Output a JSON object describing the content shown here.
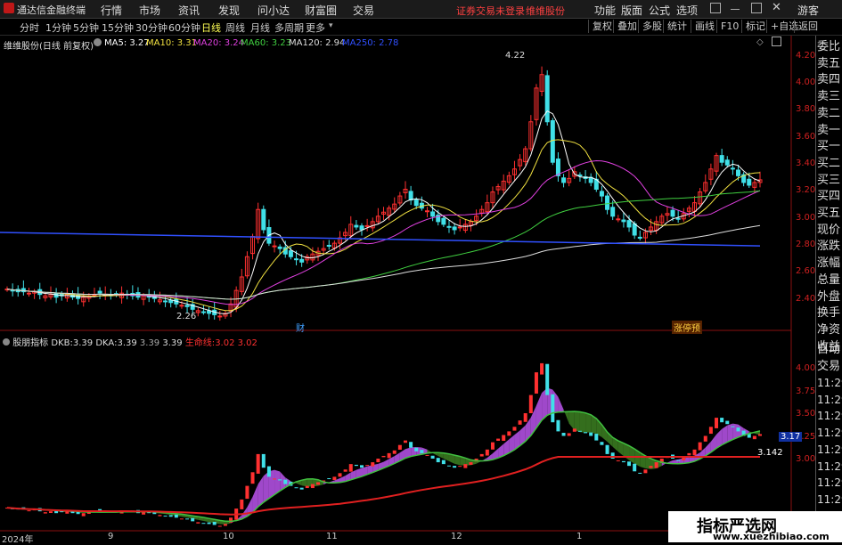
{
  "app": {
    "name": "通达信金融终端",
    "menu": [
      "行情",
      "市场",
      "资讯",
      "发现",
      "问小达",
      "财富圈",
      "交易"
    ],
    "notice": "证券交易未登录",
    "stock_tag": "维维股份",
    "right_menu": [
      "功能",
      "版面",
      "公式",
      "选项"
    ],
    "guest": "游客"
  },
  "period_tabs": [
    "分时",
    "1分钟",
    "5分钟",
    "15分钟",
    "30分钟",
    "60分钟",
    "日线",
    "周线",
    "月线",
    "多周期",
    "更多"
  ],
  "active_period": "日线",
  "toolbar": [
    "复权",
    "叠加",
    "多股",
    "统计",
    "画线",
    "F10",
    "标记",
    "+自选",
    "返回"
  ],
  "main_legend": {
    "title": "维维股份(日线 前复权)",
    "ma": [
      {
        "label": "MA5:",
        "value": "3.27",
        "color": "#ffffff"
      },
      {
        "label": "MA10:",
        "value": "3.31",
        "color": "#f0e040"
      },
      {
        "label": "MA20:",
        "value": "3.24",
        "color": "#e040e0"
      },
      {
        "label": "MA60:",
        "value": "3.23",
        "color": "#40d040"
      },
      {
        "label": "MA120:",
        "value": "2.94",
        "color": "#dddddd"
      },
      {
        "label": "MA250:",
        "value": "2.78",
        "color": "#3050ff"
      }
    ]
  },
  "main_axis": [
    "4.20",
    "4.00",
    "3.80",
    "3.60",
    "3.40",
    "3.20",
    "3.00",
    "2.80",
    "2.60",
    "2.40"
  ],
  "price_marks": {
    "high": "4.22",
    "low": "2.26"
  },
  "event_marks": {
    "cai": "财",
    "zhangting": "涨停预"
  },
  "indicator_legend": {
    "name": "股朋指标",
    "dkb_label": "DKB:",
    "dkb": "3.39",
    "dka_label": "DKA:",
    "dka": "3.39",
    "v3": "3.39",
    "v4": "3.39",
    "life_label": "生命线:",
    "life": "3.02",
    "life2": "3.02"
  },
  "ind_axis": [
    "4.00",
    "3.75",
    "3.50",
    "3.25",
    "3.00"
  ],
  "ind_current": "3.17",
  "ind_life_value": "3.142",
  "date_labels": [
    "2024年",
    "9",
    "10",
    "11",
    "12",
    "1"
  ],
  "side_quote": [
    "委比",
    "卖五",
    "卖四",
    "卖三",
    "卖二",
    "卖一",
    "买一",
    "买二",
    "买三",
    "买四",
    "买五",
    "现价",
    "涨跌",
    "涨幅",
    "总量",
    "外盘",
    "换手",
    "净资",
    "收益"
  ],
  "side_trade": [
    "自动",
    "交易"
  ],
  "side_times": [
    "11:29",
    "11:29",
    "11:29",
    "11:29",
    "11:29",
    "11:29",
    "11:29",
    "11:29",
    "11:29",
    "11:29"
  ],
  "watermark": {
    "title": "指标严选网",
    "url": "www.xuezhibiao.com"
  },
  "chart_data": {
    "type": "candlestick",
    "price_range": [
      2.26,
      4.22
    ],
    "closes": [
      2.46,
      2.45,
      2.44,
      2.44,
      2.43,
      2.44,
      2.42,
      2.41,
      2.42,
      2.4,
      2.41,
      2.42,
      2.4,
      2.39,
      2.4,
      2.41,
      2.42,
      2.43,
      2.42,
      2.41,
      2.42,
      2.43,
      2.42,
      2.41,
      2.4,
      2.41,
      2.4,
      2.39,
      2.38,
      2.37,
      2.36,
      2.35,
      2.34,
      2.33,
      2.31,
      2.3,
      2.29,
      2.28,
      2.27,
      2.26,
      2.28,
      2.35,
      2.45,
      2.55,
      2.7,
      2.85,
      3.05,
      2.9,
      2.8,
      2.78,
      2.76,
      2.72,
      2.7,
      2.68,
      2.66,
      2.7,
      2.72,
      2.74,
      2.76,
      2.78,
      2.8,
      2.84,
      2.88,
      2.94,
      2.92,
      2.9,
      2.93,
      2.96,
      3.0,
      3.03,
      3.06,
      3.09,
      3.15,
      3.2,
      3.12,
      3.08,
      3.06,
      3.04,
      3.0,
      2.96,
      2.94,
      2.92,
      2.9,
      2.92,
      2.94,
      2.96,
      3.0,
      3.05,
      3.1,
      3.18,
      3.22,
      3.26,
      3.3,
      3.35,
      3.42,
      3.5,
      3.7,
      3.95,
      4.05,
      3.7,
      3.4,
      3.3,
      3.25,
      3.28,
      3.33,
      3.3,
      3.28,
      3.25,
      3.2,
      3.15,
      3.05,
      3.0,
      2.98,
      2.96,
      2.92,
      2.86,
      2.84,
      2.88,
      2.92,
      2.96,
      3.0,
      3.02,
      3.0,
      2.98,
      3.02,
      3.06,
      3.1,
      3.18,
      3.25,
      3.35,
      3.45,
      3.4,
      3.38,
      3.35,
      3.3,
      3.25,
      3.23,
      3.25,
      3.27
    ],
    "ma250": [
      2.88,
      2.78
    ],
    "life_line": [
      3.02
    ]
  }
}
